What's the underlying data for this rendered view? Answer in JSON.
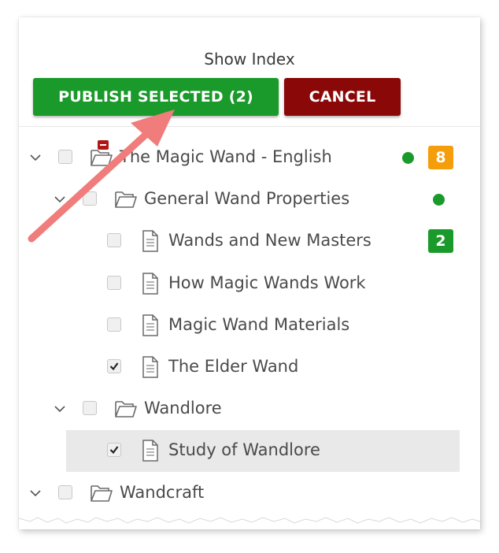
{
  "header": {
    "title": "Show Index"
  },
  "buttons": {
    "publish_label": "PUBLISH SELECTED (2)",
    "cancel_label": "CANCEL"
  },
  "tree": [
    {
      "label": "The Magic Wand - English",
      "level": 0,
      "expanded": true,
      "type": "folder",
      "checked": false,
      "status_dot": true,
      "badge": "8",
      "badge_color": "#f59d0a",
      "flag": "minus"
    },
    {
      "label": "General Wand Properties",
      "level": 1,
      "expanded": true,
      "type": "folder",
      "checked": false,
      "status_dot": true
    },
    {
      "label": "Wands and New Masters",
      "level": 2,
      "type": "document",
      "checked": false,
      "badge": "2",
      "badge_color": "#1a9a2a"
    },
    {
      "label": "How Magic Wands Work",
      "level": 2,
      "type": "document",
      "checked": false
    },
    {
      "label": "Magic Wand Materials",
      "level": 2,
      "type": "document",
      "checked": false
    },
    {
      "label": "The Elder Wand",
      "level": 2,
      "type": "document",
      "checked": true
    },
    {
      "label": "Wandlore",
      "level": 1,
      "expanded": true,
      "type": "folder",
      "checked": false
    },
    {
      "label": "Study of Wandlore",
      "level": 2,
      "type": "document",
      "checked": true,
      "selected": true
    },
    {
      "label": "Wandcraft",
      "level": 0,
      "expanded": true,
      "type": "folder",
      "checked": false
    }
  ],
  "colors": {
    "publish": "#1a9a2a",
    "cancel": "#8b0808",
    "status_green": "#1a9a2a",
    "badge_orange": "#f59d0a",
    "arrow": "#f07c7c"
  }
}
